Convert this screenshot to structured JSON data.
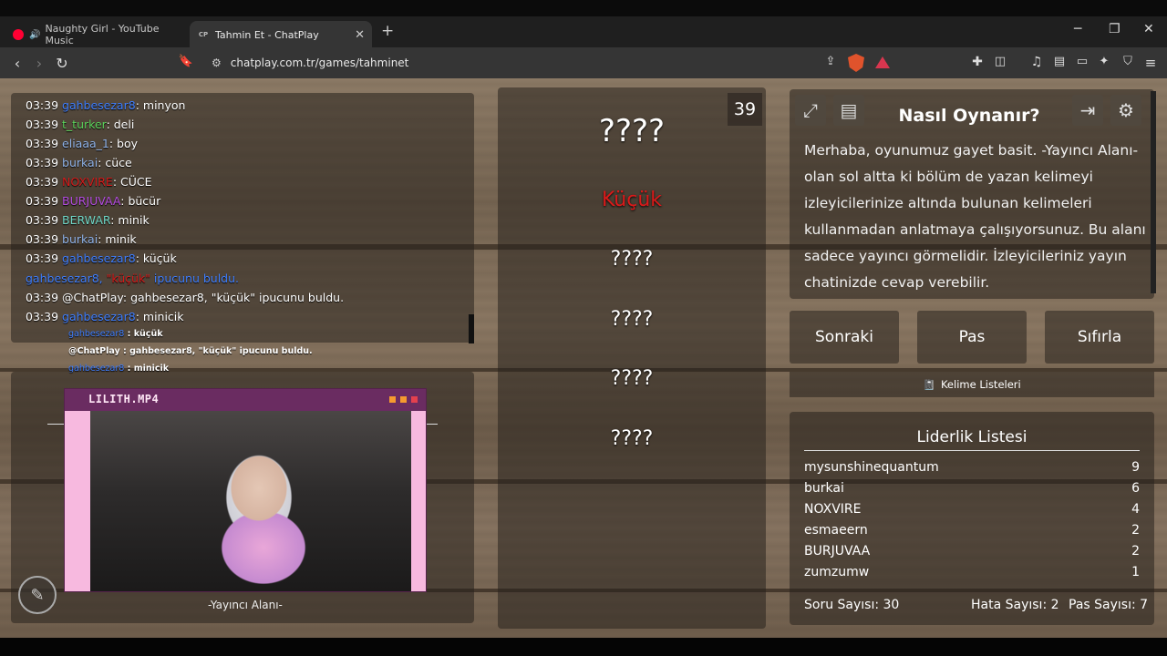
{
  "browser": {
    "tabs": [
      {
        "label": "Naughty Girl - YouTube Music"
      },
      {
        "label": "Tahmin Et - ChatPlay",
        "favicon_text": "CP"
      }
    ],
    "url": "chatplay.com.tr/games/tahminet"
  },
  "chat": {
    "lines": [
      {
        "time": "03:39",
        "user": "gahbesezar8",
        "msg": ": minyon",
        "color": "#3f7fff"
      },
      {
        "time": "03:39",
        "user": "t_turker",
        "msg": ": deli",
        "color": "#5bd25b"
      },
      {
        "time": "03:39",
        "user": "eliaaa_1",
        "msg": ": boy",
        "color": "#8fb2e8"
      },
      {
        "time": "03:39",
        "user": "burkai",
        "msg": ": cüce",
        "color": "#8fb2e8"
      },
      {
        "time": "03:39",
        "user": "NOXVIRE",
        "msg": ": CÜCE",
        "color": "#d41a1a"
      },
      {
        "time": "03:39",
        "user": "BURJUVAA",
        "msg": ": bücür",
        "color": "#b44ce0"
      },
      {
        "time": "03:39",
        "user": "BERWAR",
        "msg": ": minik",
        "color": "#6fd6c6"
      },
      {
        "time": "03:39",
        "user": "burkai",
        "msg": ": minik",
        "color": "#8fb2e8"
      },
      {
        "time": "03:39",
        "user": "gahbesezar8",
        "msg": ": küçük",
        "color": "#3f7fff"
      }
    ],
    "system_line": {
      "user": "gahbesezar8,",
      "word": "\"küçük\"",
      "rest": " ipucunu buldu."
    },
    "bot_line": {
      "time": "03:39",
      "text": "@ChatPlay: gahbesezar8, \"küçük\" ipucunu buldu."
    },
    "last_line": {
      "time": "03:39",
      "user": "gahbesezar8",
      "msg": ": minicik"
    },
    "overlay": [
      {
        "user": "gahbesezar8",
        "msg": " : küçük"
      },
      {
        "text": "@ChatPlay : gahbesezar8, \"küçük\" ipucunu buldu."
      },
      {
        "user": "gahbesezar8",
        "msg": " : minicik"
      }
    ]
  },
  "stream": {
    "window_title": "LILITH.MP4",
    "caption": "-Yayıncı Alanı-"
  },
  "game": {
    "counter": "39",
    "words": [
      "????",
      "Küçük",
      "????",
      "????",
      "????",
      "????"
    ]
  },
  "howto": {
    "title": "Nasıl Oynanır?",
    "text": "Merhaba, oyunumuz gayet basit. -Yayıncı Alanı- olan sol altta ki bölüm de yazan kelimeyi izleyicilerinize altında bulunan kelimeleri kullanmadan anlatmaya çalışıyorsunuz. Bu alanı sadece yayıncı görmelidir. İzleyicileriniz yayın chatinizde cevap verebilir."
  },
  "buttons": {
    "next": "Sonraki",
    "pass": "Pas",
    "reset": "Sıfırla",
    "word_lists": "Kelime Listeleri"
  },
  "leaderboard": {
    "title": "Liderlik Listesi",
    "rows": [
      {
        "name": "mysunshinequantum",
        "score": "9"
      },
      {
        "name": "burkai",
        "score": "6"
      },
      {
        "name": "NOXVIRE",
        "score": "4"
      },
      {
        "name": "esmaeern",
        "score": "2"
      },
      {
        "name": "BURJUVAA",
        "score": "2"
      },
      {
        "name": "zumzumw",
        "score": "1"
      }
    ],
    "questions": "Soru Sayısı: 30",
    "errors": "Hata Sayısı: 2",
    "passes": "Pas Sayısı: 7"
  }
}
